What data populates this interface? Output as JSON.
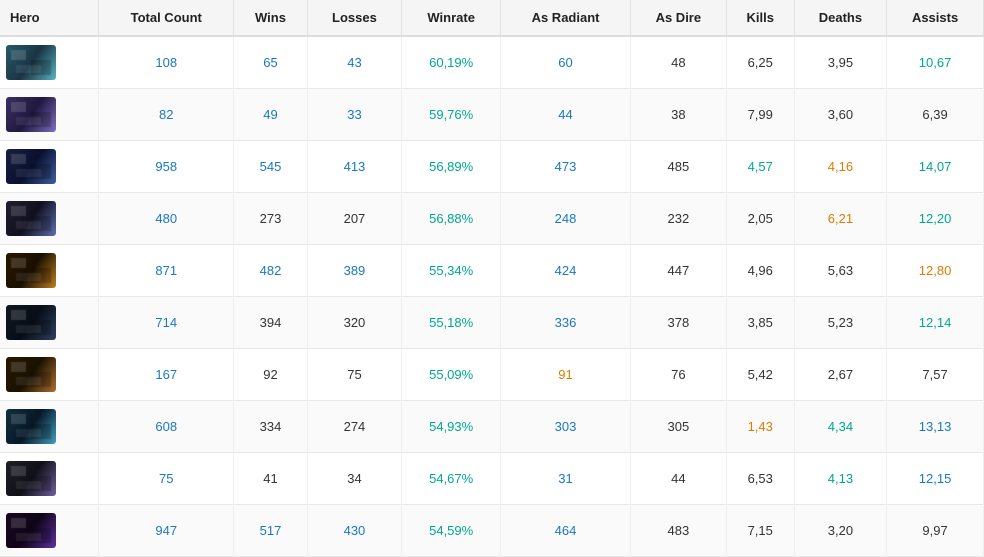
{
  "table": {
    "columns": [
      {
        "key": "hero",
        "label": "Hero"
      },
      {
        "key": "total_count",
        "label": "Total Count"
      },
      {
        "key": "wins",
        "label": "Wins"
      },
      {
        "key": "losses",
        "label": "Losses"
      },
      {
        "key": "winrate",
        "label": "Winrate"
      },
      {
        "key": "as_radiant",
        "label": "As Radiant"
      },
      {
        "key": "as_dire",
        "label": "As Dire"
      },
      {
        "key": "kills",
        "label": "Kills"
      },
      {
        "key": "deaths",
        "label": "Deaths"
      },
      {
        "key": "assists",
        "label": "Assists"
      }
    ],
    "rows": [
      {
        "hero_color": "#2a5a6a",
        "hero_accent": "#5ab3c4",
        "total_count": "108",
        "total_color": "blue",
        "wins": "65",
        "wins_color": "blue",
        "losses": "43",
        "losses_color": "blue",
        "winrate": "60,19%",
        "winrate_color": "teal",
        "as_radiant": "60",
        "as_radiant_color": "blue",
        "as_dire": "48",
        "as_dire_color": "default",
        "kills": "6,25",
        "kills_color": "default",
        "deaths": "3,95",
        "deaths_color": "default",
        "assists": "10,67",
        "assists_color": "teal"
      },
      {
        "hero_color": "#3a3060",
        "hero_accent": "#8070c0",
        "total_count": "82",
        "total_color": "blue",
        "wins": "49",
        "wins_color": "blue",
        "losses": "33",
        "losses_color": "blue",
        "winrate": "59,76%",
        "winrate_color": "teal",
        "as_radiant": "44",
        "as_radiant_color": "blue",
        "as_dire": "38",
        "as_dire_color": "default",
        "kills": "7,99",
        "kills_color": "default",
        "deaths": "3,60",
        "deaths_color": "default",
        "assists": "6,39",
        "assists_color": "default"
      },
      {
        "hero_color": "#1a2040",
        "hero_accent": "#4060a0",
        "total_count": "958",
        "total_color": "blue",
        "wins": "545",
        "wins_color": "blue",
        "losses": "413",
        "losses_color": "blue",
        "winrate": "56,89%",
        "winrate_color": "teal",
        "as_radiant": "473",
        "as_radiant_color": "blue",
        "as_dire": "485",
        "as_dire_color": "default",
        "kills": "4,57",
        "kills_color": "teal",
        "deaths": "4,16",
        "deaths_color": "orange",
        "assists": "14,07",
        "assists_color": "teal"
      },
      {
        "hero_color": "#202030",
        "hero_accent": "#6070b0",
        "total_count": "480",
        "total_color": "blue",
        "wins": "273",
        "wins_color": "default",
        "losses": "207",
        "losses_color": "default",
        "winrate": "56,88%",
        "winrate_color": "teal",
        "as_radiant": "248",
        "as_radiant_color": "blue",
        "as_dire": "232",
        "as_dire_color": "default",
        "kills": "2,05",
        "kills_color": "default",
        "deaths": "6,21",
        "deaths_color": "orange",
        "assists": "12,20",
        "assists_color": "teal"
      },
      {
        "hero_color": "#2a1800",
        "hero_accent": "#c08020",
        "total_count": "871",
        "total_color": "blue",
        "wins": "482",
        "wins_color": "blue",
        "losses": "389",
        "losses_color": "blue",
        "winrate": "55,34%",
        "winrate_color": "teal",
        "as_radiant": "424",
        "as_radiant_color": "blue",
        "as_dire": "447",
        "as_dire_color": "default",
        "kills": "4,96",
        "kills_color": "default",
        "deaths": "5,63",
        "deaths_color": "default",
        "assists": "12,80",
        "assists_color": "orange"
      },
      {
        "hero_color": "#101820",
        "hero_accent": "#304060",
        "total_count": "714",
        "total_color": "blue",
        "wins": "394",
        "wins_color": "default",
        "losses": "320",
        "losses_color": "default",
        "winrate": "55,18%",
        "winrate_color": "teal",
        "as_radiant": "336",
        "as_radiant_color": "blue",
        "as_dire": "378",
        "as_dire_color": "default",
        "kills": "3,85",
        "kills_color": "default",
        "deaths": "5,23",
        "deaths_color": "default",
        "assists": "12,14",
        "assists_color": "teal"
      },
      {
        "hero_color": "#2a1800",
        "hero_accent": "#b07030",
        "total_count": "167",
        "total_color": "blue",
        "wins": "92",
        "wins_color": "default",
        "losses": "75",
        "losses_color": "default",
        "winrate": "55,09%",
        "winrate_color": "teal",
        "as_radiant": "91",
        "as_radiant_color": "orange",
        "as_dire": "76",
        "as_dire_color": "default",
        "kills": "5,42",
        "kills_color": "default",
        "deaths": "2,67",
        "deaths_color": "default",
        "assists": "7,57",
        "assists_color": "default"
      },
      {
        "hero_color": "#103040",
        "hero_accent": "#40a0c0",
        "total_count": "608",
        "total_color": "blue",
        "wins": "334",
        "wins_color": "default",
        "losses": "274",
        "losses_color": "default",
        "winrate": "54,93%",
        "winrate_color": "teal",
        "as_radiant": "303",
        "as_radiant_color": "blue",
        "as_dire": "305",
        "as_dire_color": "default",
        "kills": "1,43",
        "kills_color": "orange",
        "deaths": "4,34",
        "deaths_color": "teal",
        "assists": "13,13",
        "assists_color": "blue"
      },
      {
        "hero_color": "#202028",
        "hero_accent": "#7060a0",
        "total_count": "75",
        "total_color": "blue",
        "wins": "41",
        "wins_color": "default",
        "losses": "34",
        "losses_color": "default",
        "winrate": "54,67%",
        "winrate_color": "teal",
        "as_radiant": "31",
        "as_radiant_color": "blue",
        "as_dire": "44",
        "as_dire_color": "default",
        "kills": "6,53",
        "kills_color": "default",
        "deaths": "4,13",
        "deaths_color": "teal",
        "assists": "12,15",
        "assists_color": "blue"
      },
      {
        "hero_color": "#180820",
        "hero_accent": "#6030a0",
        "total_count": "947",
        "total_color": "blue",
        "wins": "517",
        "wins_color": "blue",
        "losses": "430",
        "losses_color": "blue",
        "winrate": "54,59%",
        "winrate_color": "teal",
        "as_radiant": "464",
        "as_radiant_color": "blue",
        "as_dire": "483",
        "as_dire_color": "default",
        "kills": "7,15",
        "kills_color": "default",
        "deaths": "3,20",
        "deaths_color": "default",
        "assists": "9,97",
        "assists_color": "default"
      }
    ],
    "hero_gradients": [
      [
        "#2a5a6a",
        "#1a3545",
        "#5ab3c4"
      ],
      [
        "#3a3060",
        "#201840",
        "#8070c0"
      ],
      [
        "#1a2040",
        "#0a1030",
        "#4060a0"
      ],
      [
        "#202030",
        "#101020",
        "#6070b0"
      ],
      [
        "#2a1800",
        "#1a1000",
        "#c08020"
      ],
      [
        "#101820",
        "#080e18",
        "#304060"
      ],
      [
        "#2a1800",
        "#1a1200",
        "#b07030"
      ],
      [
        "#103040",
        "#081828",
        "#40a0c0"
      ],
      [
        "#202028",
        "#101018",
        "#7060a0"
      ],
      [
        "#180820",
        "#100518",
        "#6030a0"
      ]
    ]
  }
}
